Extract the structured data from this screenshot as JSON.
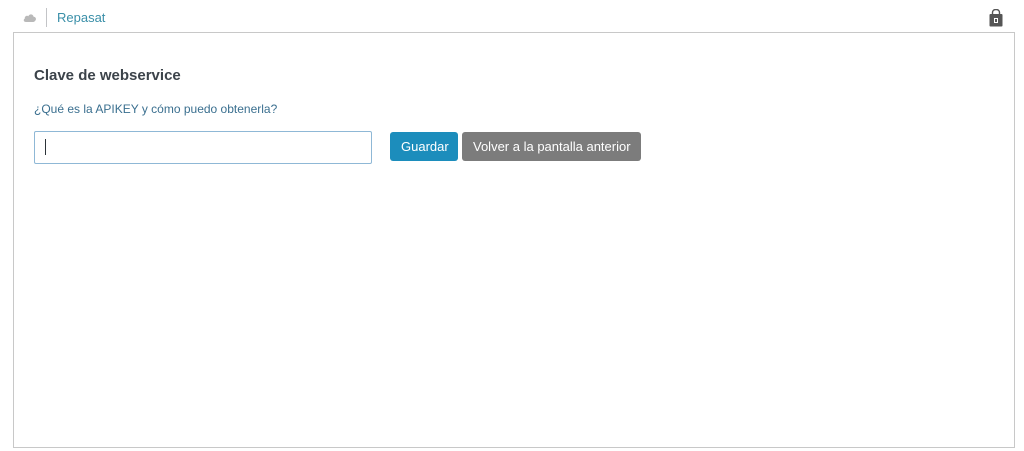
{
  "topbar": {
    "app_title": "Repasat",
    "logo_icon": "cloud-logo-icon",
    "store_icon": "shopping-bag-icon"
  },
  "panel": {
    "title": "Clave de webservice",
    "help_link": "¿Qué es la APIKEY y cómo puedo obtenerla?",
    "apikey_input": {
      "value": "",
      "placeholder": ""
    },
    "save_label": "Guardar",
    "back_label": "Volver a la pantalla anterior"
  },
  "colors": {
    "accent": "#1c8dbc",
    "secondary_button": "#7c7c7c",
    "link": "#3a6f8f"
  }
}
